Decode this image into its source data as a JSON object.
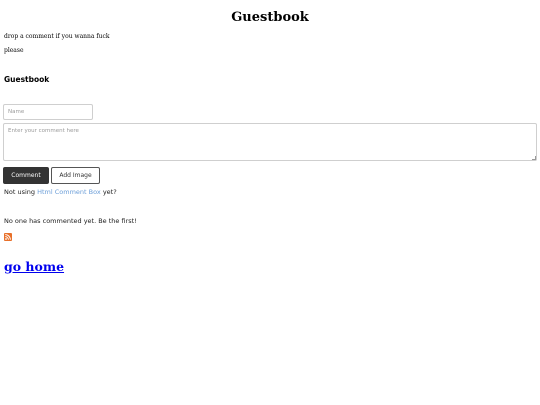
{
  "page": {
    "title": "Guestbook",
    "intro_lines": [
      "drop a comment if you wanna fuck",
      "please"
    ]
  },
  "comment_box": {
    "section_title": "Guestbook",
    "name_placeholder": "Name",
    "comment_placeholder": "Enter your comment here",
    "comment_button": "Comment",
    "add_image_button": "Add Image",
    "footer_prefix": "Not using",
    "footer_link": "Html Comment Box",
    "footer_suffix": "yet?",
    "empty_message": "No one has commented yet. Be the first!",
    "rss_icon": "rss-icon",
    "colors": {
      "link": "#6b9ed8",
      "button_dark": "#333333",
      "rss": "#e8702a"
    }
  },
  "nav": {
    "home_link": "go home"
  }
}
